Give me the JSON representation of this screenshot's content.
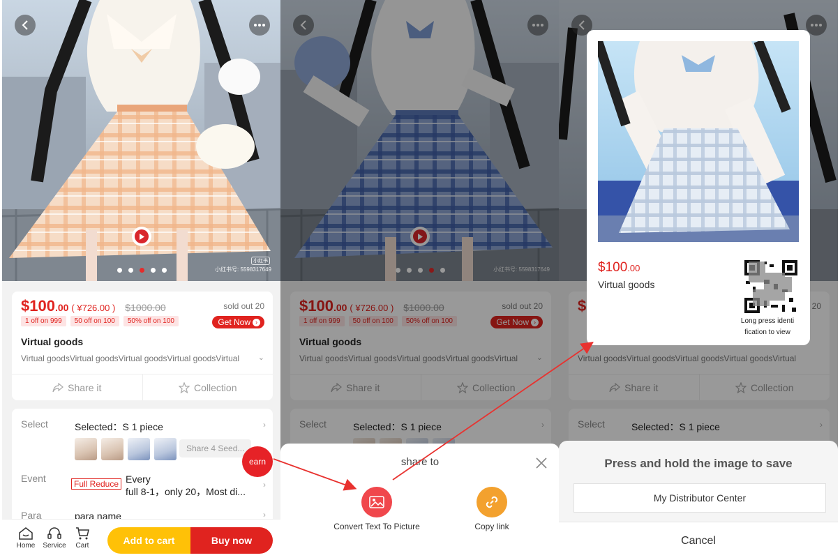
{
  "product": {
    "price_main": "$100",
    "price_cents": ".00",
    "price_cny": "( ¥726.00 )",
    "price_original": "$1000.00",
    "sold": "sold out 20",
    "coupons": [
      "1 off on 999",
      "50 off on 100",
      "50% off on 100"
    ],
    "get_now": "Get Now",
    "title": "Virtual goods",
    "desc": "Virtual goodsVirtual goodsVirtual goodsVirtual goodsVirtual",
    "share_label": "Share it",
    "collection_label": "Collection",
    "watermark": "小红书号: 5598317649",
    "watermark_tag": "小红书"
  },
  "select": {
    "label": "Select",
    "value": "Selected：S   1  piece",
    "seed_text": "Share 4 Seed..."
  },
  "event": {
    "label": "Event",
    "tag": "Full Reduce",
    "line1": "Every",
    "line2": "full 8-1，only 20，Most di..."
  },
  "para": {
    "label": "Para",
    "value": "para name"
  },
  "earn_label": "earn",
  "bottom": {
    "home": "Home",
    "service": "Service",
    "cart": "Cart",
    "add_to_cart": "Add to cart",
    "buy_now": "Buy now"
  },
  "share_sheet": {
    "title": "share to",
    "convert": "Convert Text To Picture",
    "copy_link": "Copy link"
  },
  "poster": {
    "price_main": "$100",
    "price_cents": ".00",
    "title": "Virtual goods",
    "qr_note_line1": "Long press identi",
    "qr_note_line2": "fication to view"
  },
  "save_sheet": {
    "title": "Press and hold the image to save",
    "distributor": "My Distributor Center",
    "cancel": "Cancel"
  },
  "colors": {
    "accent_red": "#e0231f",
    "cart_yellow": "#ffc107",
    "link_orange": "#f3a12e"
  }
}
